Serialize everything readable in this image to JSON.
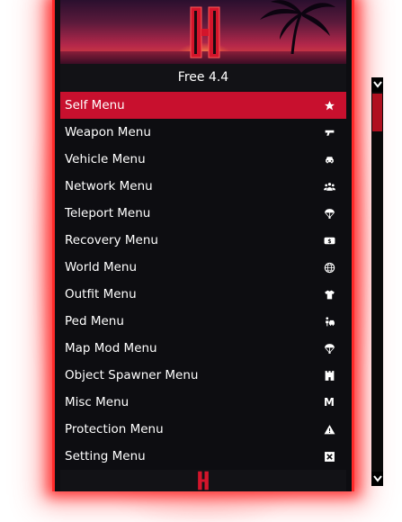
{
  "header": {
    "version": "Free 4.4"
  },
  "menu": {
    "items": [
      {
        "label": "Self Menu",
        "icon": "star-icon",
        "selected": true
      },
      {
        "label": "Weapon Menu",
        "icon": "gun-icon",
        "selected": false
      },
      {
        "label": "Vehicle Menu",
        "icon": "car-icon",
        "selected": false
      },
      {
        "label": "Network Menu",
        "icon": "users-icon",
        "selected": false
      },
      {
        "label": "Teleport Menu",
        "icon": "parachute-icon",
        "selected": false
      },
      {
        "label": "Recovery Menu",
        "icon": "money-icon",
        "selected": false
      },
      {
        "label": "World Menu",
        "icon": "globe-icon",
        "selected": false
      },
      {
        "label": "Outfit Menu",
        "icon": "shirt-icon",
        "selected": false
      },
      {
        "label": "Ped Menu",
        "icon": "ped-icon",
        "selected": false
      },
      {
        "label": "Map Mod Menu",
        "icon": "parachute-icon",
        "selected": false
      },
      {
        "label": "Object Spawner Menu",
        "icon": "tower-icon",
        "selected": false
      },
      {
        "label": "Misc Menu",
        "icon": "m-letter-icon",
        "selected": false
      },
      {
        "label": "Protection Menu",
        "icon": "warning-icon",
        "selected": false
      },
      {
        "label": "Setting Menu",
        "icon": "box-x-icon",
        "selected": false
      }
    ],
    "misc_icon_glyph": "M"
  },
  "colors": {
    "accent": "#c8102e",
    "glow": "#ff2a2a",
    "panel_bg": "#0d0d11"
  }
}
